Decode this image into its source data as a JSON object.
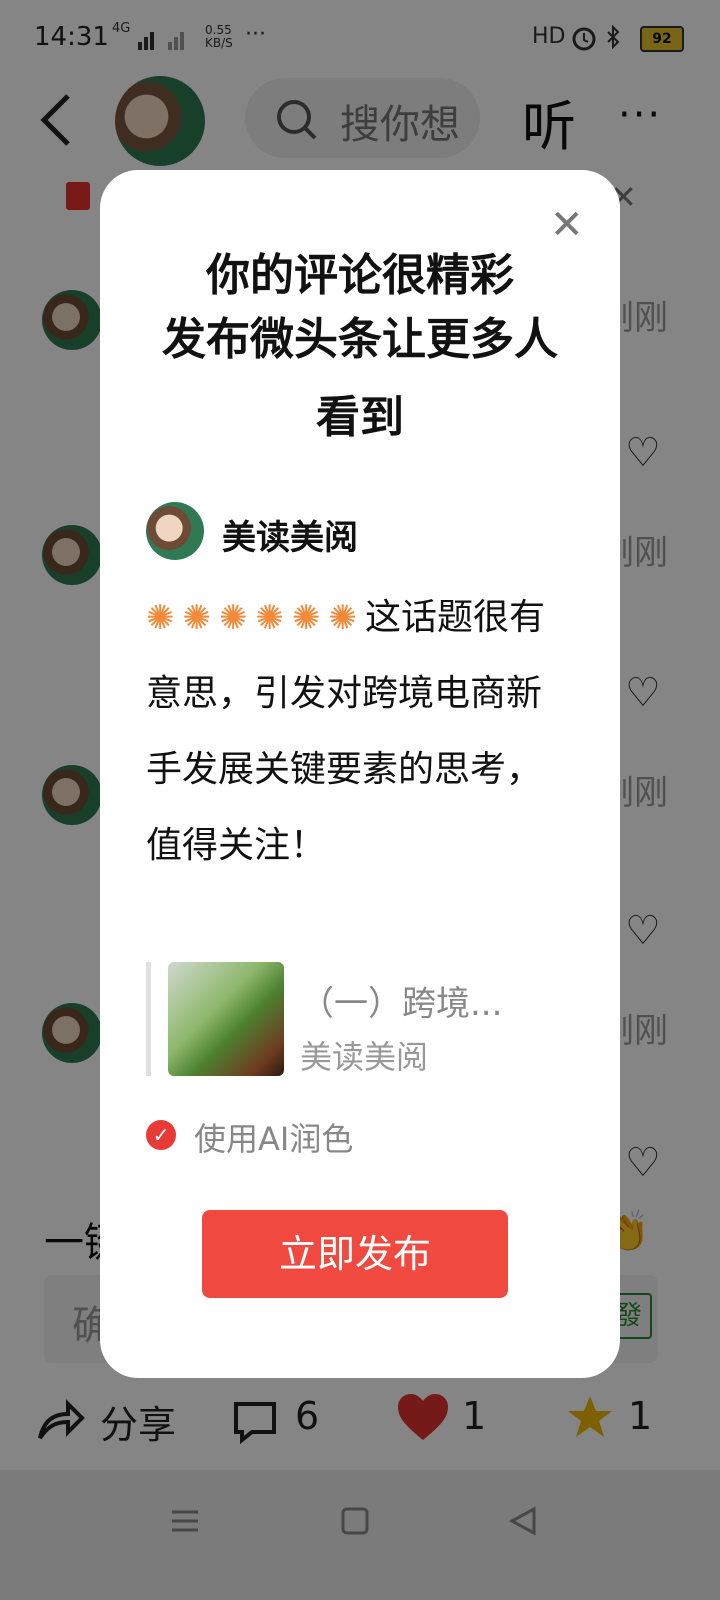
{
  "status_bar": {
    "time": "14:31",
    "network": "4G",
    "speed_value": "0.55",
    "speed_unit": "KB/S",
    "hd": "HD",
    "battery": "92",
    "more": "···"
  },
  "header": {
    "search_placeholder": "搜你想",
    "listen": "听",
    "more": "···"
  },
  "background": {
    "timestamps": [
      "刚刚",
      "刚刚",
      "刚刚",
      "刚刚"
    ],
    "one_click_prefix": "一键",
    "input_prefix": "确",
    "send_badge": "發"
  },
  "bottom_bar": {
    "share_label": "分享",
    "comment_count": "6",
    "like_count": "1",
    "fav_count": "1"
  },
  "modal": {
    "title_line1": "你的评论很精彩",
    "title_line2": "发布微头条让更多人",
    "title_line3": "看到",
    "author_name": "美读美阅",
    "comment_text": "这话题很有意思，引发对跨境电商新手发展关键要素的思考，值得关注！",
    "quote_title": "（一）跨境...",
    "quote_author": "美读美阅",
    "ai_polish_label": "使用AI润色",
    "publish_label": "立即发布"
  }
}
